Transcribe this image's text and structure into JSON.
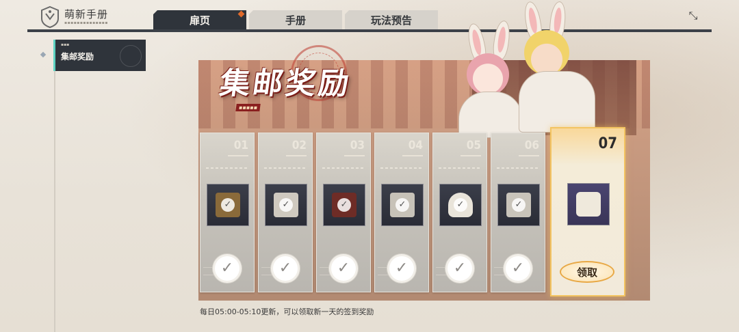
{
  "header": {
    "title": "萌新手册",
    "logo_icon": "crest-icon",
    "tabs": [
      {
        "label": "扉页",
        "active": true
      },
      {
        "label": "手册",
        "active": false
      },
      {
        "label": "玩法预告",
        "active": false
      }
    ],
    "close_icon": "close-arrows-icon"
  },
  "sidebar": {
    "items": [
      {
        "label": "集邮奖励",
        "active": true
      }
    ]
  },
  "event": {
    "title": "集邮奖励",
    "days": [
      {
        "day": "01",
        "claimed": true,
        "reward_icon": "portrait-box-icon"
      },
      {
        "day": "02",
        "claimed": true,
        "reward_icon": "treasure-chest-icon"
      },
      {
        "day": "03",
        "claimed": true,
        "reward_icon": "cape-icon"
      },
      {
        "day": "04",
        "claimed": true,
        "reward_icon": "treasure-chest-icon"
      },
      {
        "day": "05",
        "claimed": true,
        "reward_icon": "headwear-icon"
      },
      {
        "day": "06",
        "claimed": true,
        "reward_icon": "treasure-chest-icon"
      },
      {
        "day": "07",
        "claimed": false,
        "reward_icon": "bunny-cart-icon"
      }
    ],
    "claim_label": "领取",
    "footer_note": "每日05:00-05:10更新，可以领取新一天的签到奖励"
  },
  "colors": {
    "active_tab": "#2f343b",
    "accent_teal": "#5ed3c2",
    "claim_border": "#e8a845",
    "today_card_gold": "#f3c461"
  }
}
